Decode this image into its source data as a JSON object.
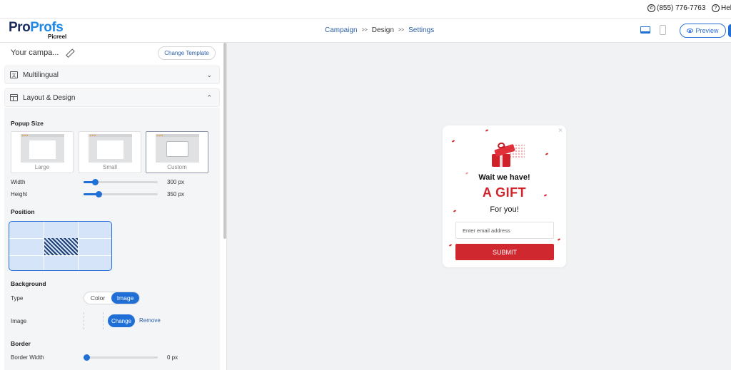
{
  "topbar": {
    "phone": "(855) 776-7763",
    "help": "Help",
    "phone_icon": "phone-icon",
    "help_icon": "question-icon"
  },
  "header": {
    "logo_brand_pro": "Pro",
    "logo_brand_profs": "Profs",
    "logo_sub": "Picreel",
    "breadcrumbs": [
      "Campaign",
      ">>",
      "Design",
      ">>",
      "Settings"
    ],
    "preview_label": "Preview",
    "active_device": "desktop"
  },
  "panel": {
    "campaign_name": "Your campa...",
    "change_template": "Change Template",
    "multilingual_label": "Multilingual",
    "layout_label": "Layout & Design",
    "popup_size_title": "Popup Size",
    "sizes": [
      {
        "label": "Large"
      },
      {
        "label": "Small"
      },
      {
        "label": "Custom",
        "selected": true
      }
    ],
    "width_label": "Width",
    "width_value": "300 px",
    "width_level": 0.15,
    "height_label": "Height",
    "height_value": "350 px",
    "height_level": 0.2,
    "position_title": "Position",
    "position_selected": "center",
    "background_title": "Background",
    "type_label": "Type",
    "type_options": [
      "Color",
      "Image"
    ],
    "type_selected": "Image",
    "image_label": "Image",
    "change_label": "Change",
    "remove_label": "Remove",
    "border_title": "Border",
    "border_width_label": "Border Width",
    "border_width_value": "0 px",
    "border_width_level": 0
  },
  "popup": {
    "line1": "Wait we have!",
    "line2": "A GIFT",
    "line3": "For you!",
    "email_placeholder": "Enter email address",
    "submit_label": "SUBMIT",
    "close_glyph": "×"
  },
  "colors": {
    "accent": "#1f6fd6",
    "popup_red": "#d0282f"
  }
}
